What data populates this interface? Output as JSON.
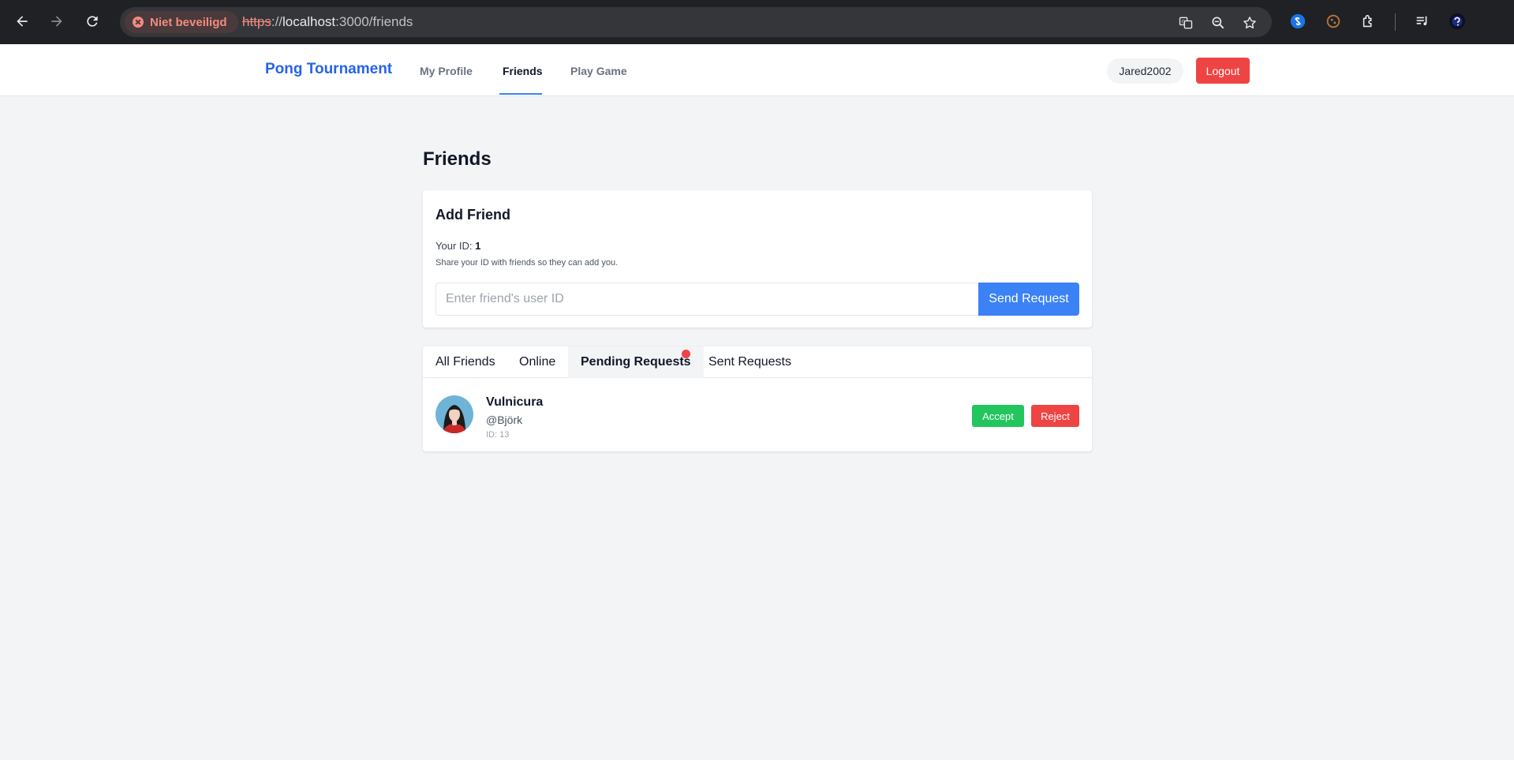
{
  "browser": {
    "security_label": "Niet beveiligd",
    "url_scheme": "https",
    "url_sep": "://",
    "url_host": "localhost",
    "url_path": ":3000/friends"
  },
  "header": {
    "brand": "Pong Tournament",
    "nav": [
      {
        "label": "My Profile",
        "active": false
      },
      {
        "label": "Friends",
        "active": true
      },
      {
        "label": "Play Game",
        "active": false
      }
    ],
    "username": "Jared2002",
    "logout_label": "Logout"
  },
  "page": {
    "title": "Friends"
  },
  "add_friend": {
    "title": "Add Friend",
    "your_id_label": "Your ID:",
    "your_id_value": "1",
    "hint": "Share your ID with friends so they can add you.",
    "input_value": "",
    "input_placeholder": "Enter friend's user ID",
    "send_label": "Send Request"
  },
  "tabs": [
    {
      "label": "All Friends",
      "active": false
    },
    {
      "label": "Online",
      "active": false
    },
    {
      "label": "Pending Requests",
      "active": true,
      "has_notification": true
    },
    {
      "label": "Sent Requests",
      "active": false
    }
  ],
  "pending": [
    {
      "name": "Vulnicura",
      "handle": "@Björk",
      "id_text": "ID: 13",
      "accept_label": "Accept",
      "reject_label": "Reject"
    }
  ],
  "colors": {
    "brand": "#2563eb",
    "primary": "#3b82f6",
    "danger": "#ef4444",
    "success": "#22c55e",
    "background": "#f3f4f6"
  }
}
